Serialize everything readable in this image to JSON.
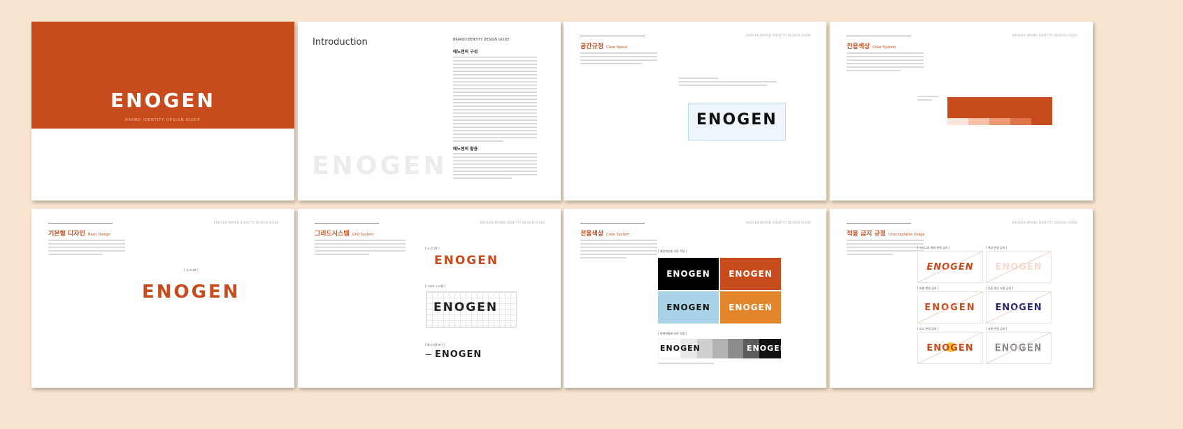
{
  "colors": {
    "brand_orange": "#c84b1e",
    "page_bg": "#f8e4cf",
    "sky_blue": "#a9d4e8",
    "amber": "#e3862b",
    "navy": "#2a2a6e"
  },
  "cover": {
    "logo": "ENOGEN",
    "subtitle": "BRAND IDENTITY DESIGN GUIDE"
  },
  "intro": {
    "title": "Introduction",
    "guide_label": "BRAND IDENTITY DESIGN GUIDE",
    "section1": "에노젠의 구성",
    "section2": "에노젠의 활용",
    "watermark": "ENOGEN"
  },
  "space": {
    "title": "공간규정",
    "subtitle": "Clear Space",
    "logo": "ENOGEN"
  },
  "color1": {
    "title": "전용색상",
    "subtitle": "Color System"
  },
  "basic": {
    "title": "기본형 디자인",
    "subtitle": "Basic Design",
    "logo": "ENOGEN"
  },
  "grid": {
    "title": "그리드시스템",
    "subtitle": "Grid System",
    "logo1": "ENOGEN",
    "logo2": "ENOGEN",
    "logo3": "ENOGEN"
  },
  "color2": {
    "title": "전용색상",
    "subtitle": "Color System",
    "tiles": [
      "ENOGEN",
      "ENOGEN",
      "ENOGEN",
      "ENOGEN"
    ],
    "gradient_left": "ENOGEN",
    "gradient_right": "ENOGEN"
  },
  "misuse": {
    "title": "적용 금지 규정",
    "subtitle": "Unacceptable Usage",
    "logos": [
      "ENOGEN",
      "ENOGEN",
      "ENOGEN",
      "ENOGEN",
      "ENOGEN",
      "ENOGEN"
    ]
  }
}
